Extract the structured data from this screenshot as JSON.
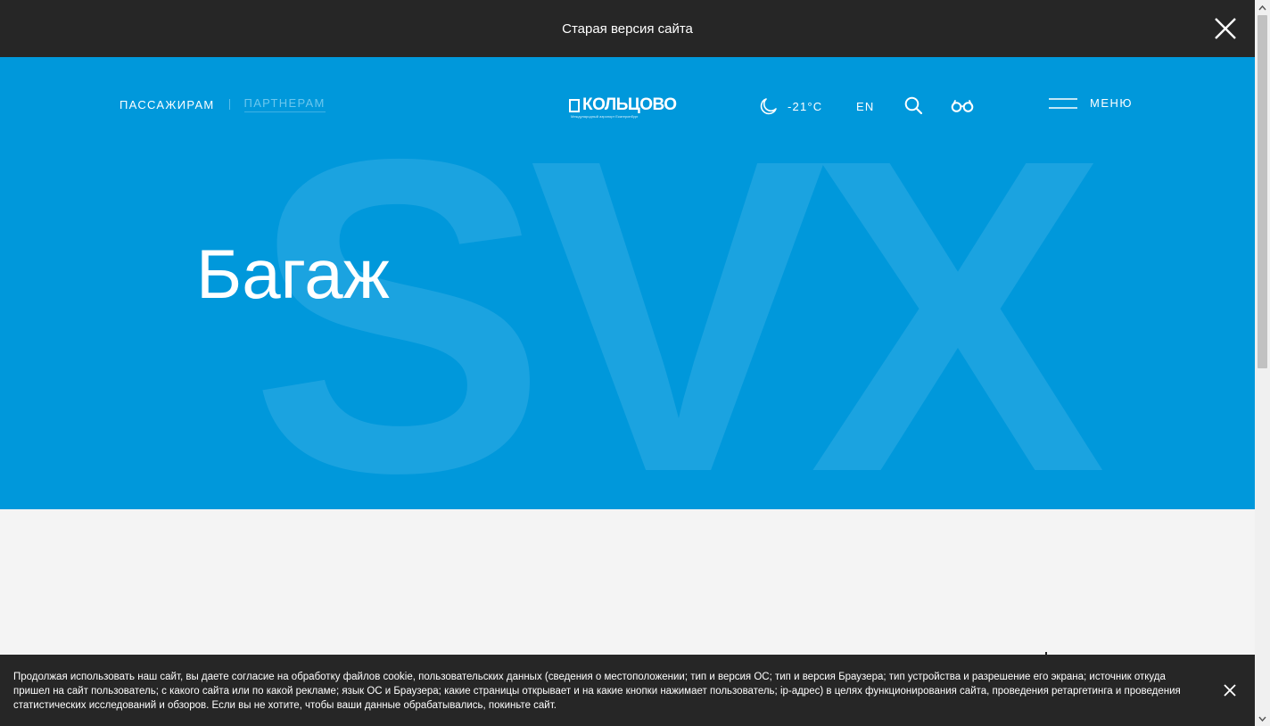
{
  "topbar": {
    "label": "Старая версия сайта"
  },
  "hero": {
    "watermark": "SVX",
    "title": "Багаж"
  },
  "nav": {
    "passengers": "ПАССАЖИРАМ",
    "partners": "ПАРТНЕРАМ"
  },
  "logo": {
    "name": "КОЛЬЦОВО",
    "tagline": "Международный аэропорт Екатеринбург"
  },
  "weather": {
    "icon": "moon-icon",
    "temperature": "-21°C"
  },
  "lang": "EN",
  "menu": {
    "label": "МЕНЮ"
  },
  "cookie": {
    "text": "Продолжая использовать наш сайт, вы даете согласие на обработку файлов cookie, пользовательских данных (сведения о местоположении; тип и версия ОС; тип и версия Браузера; тип устройства и разрешение его экрана; источник откуда пришел на сайт пользователь; с какого сайта или по какой рекламе; язык ОС и Браузера; какие страницы открывает и на какие кнопки нажимает пользователь; ip-адрес) в целях функционирования сайта, проведения ретаргетинга и проведения статистических исследований и обзоров. Если вы не хотите, чтобы ваши данные обрабатывались, покиньте сайт."
  },
  "colors": {
    "hero_bg": "#0098db",
    "watermark": "#1ba3e0",
    "dark_bar": "#262626",
    "page_bg": "#f4f4f4"
  }
}
